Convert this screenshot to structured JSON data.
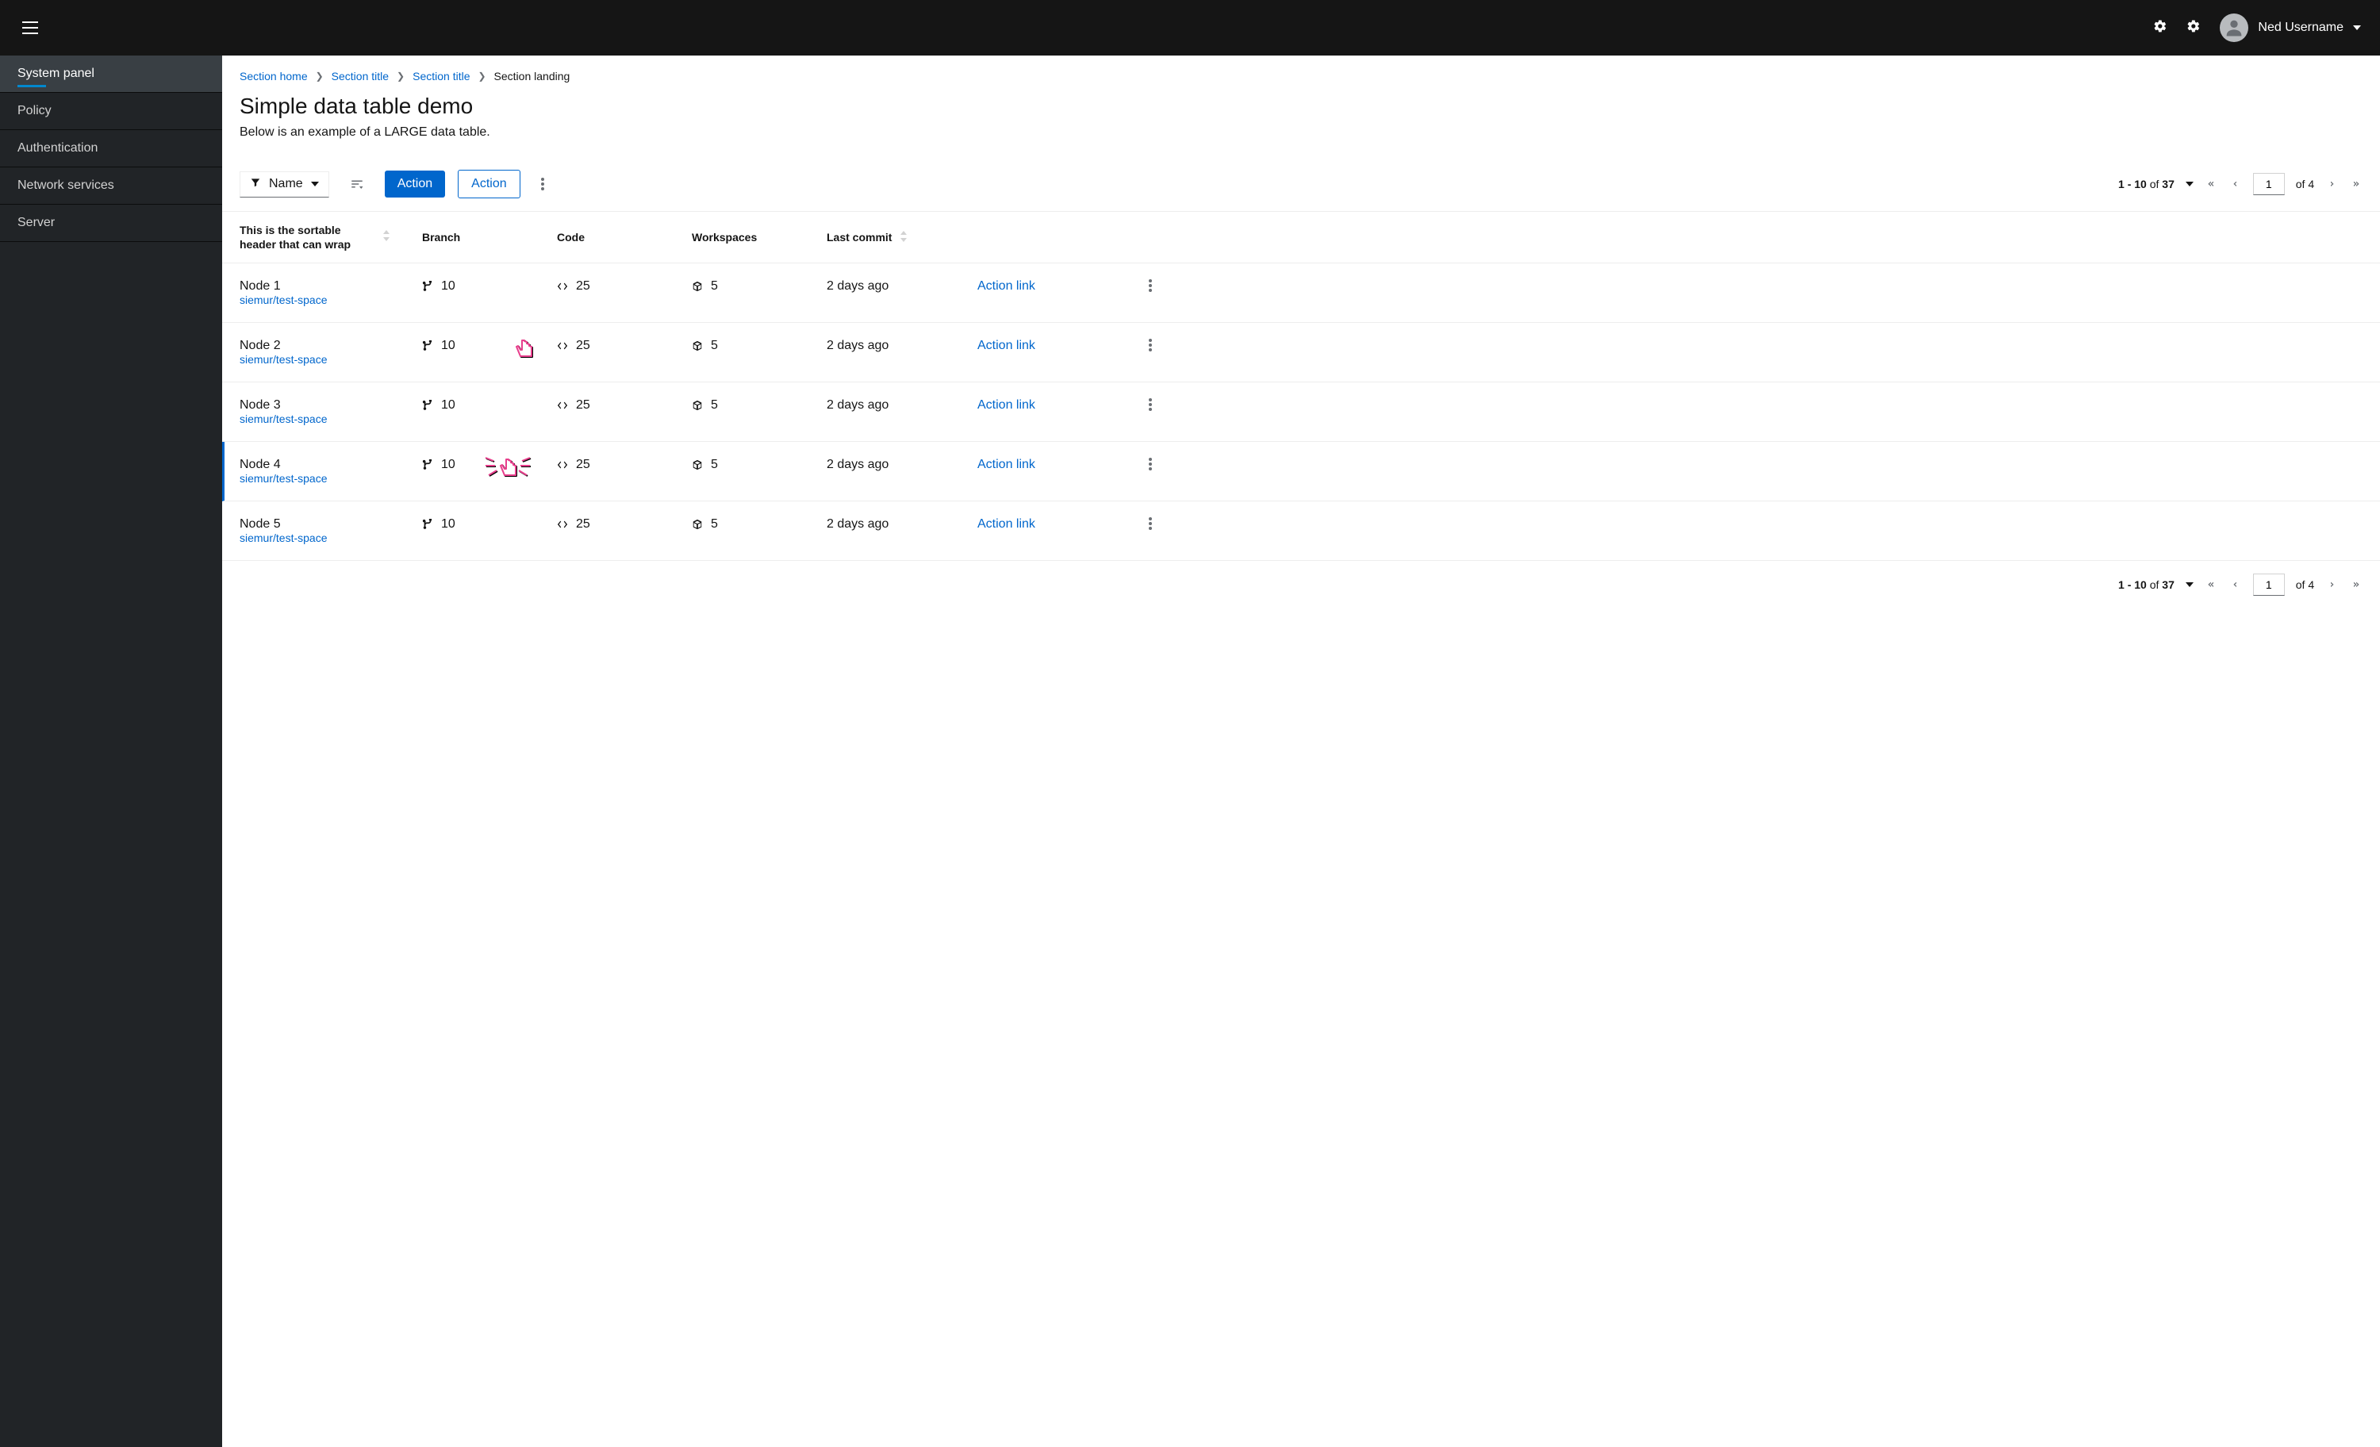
{
  "header": {
    "username": "Ned Username"
  },
  "sidebar": {
    "items": [
      {
        "label": "System panel",
        "active": true
      },
      {
        "label": "Policy",
        "active": false
      },
      {
        "label": "Authentication",
        "active": false
      },
      {
        "label": "Network services",
        "active": false
      },
      {
        "label": "Server",
        "active": false
      }
    ]
  },
  "breadcrumb": {
    "items": [
      {
        "label": "Section home",
        "link": true
      },
      {
        "label": "Section title",
        "link": true
      },
      {
        "label": "Section title",
        "link": true
      },
      {
        "label": "Section landing",
        "link": false
      }
    ]
  },
  "page": {
    "title": "Simple data table demo",
    "description": "Below is an example of a LARGE data table."
  },
  "toolbar": {
    "filter_label": "Name",
    "primary_action": "Action",
    "secondary_action": "Action"
  },
  "pagination": {
    "range_text": "1 - 10",
    "of_label": "of",
    "total_items": "37",
    "page_input": "1",
    "total_pages": "4"
  },
  "table": {
    "columns": {
      "sortable_wrap": "This is the sortable header that can wrap",
      "branch": "Branch",
      "code": "Code",
      "workspaces": "Workspaces",
      "last_commit": "Last commit"
    },
    "action_link_label": "Action link",
    "rows": [
      {
        "name": "Node 1",
        "sub": "siemur/test-space",
        "branch": "10",
        "code": "25",
        "workspaces": "5",
        "last_commit": "2 days ago",
        "selected": false
      },
      {
        "name": "Node 2",
        "sub": "siemur/test-space",
        "branch": "10",
        "code": "25",
        "workspaces": "5",
        "last_commit": "2 days ago",
        "selected": false
      },
      {
        "name": "Node 3",
        "sub": "siemur/test-space",
        "branch": "10",
        "code": "25",
        "workspaces": "5",
        "last_commit": "2 days ago",
        "selected": false
      },
      {
        "name": "Node 4",
        "sub": "siemur/test-space",
        "branch": "10",
        "code": "25",
        "workspaces": "5",
        "last_commit": "2 days ago",
        "selected": true
      },
      {
        "name": "Node 5",
        "sub": "siemur/test-space",
        "branch": "10",
        "code": "25",
        "workspaces": "5",
        "last_commit": "2 days ago",
        "selected": false
      }
    ]
  }
}
